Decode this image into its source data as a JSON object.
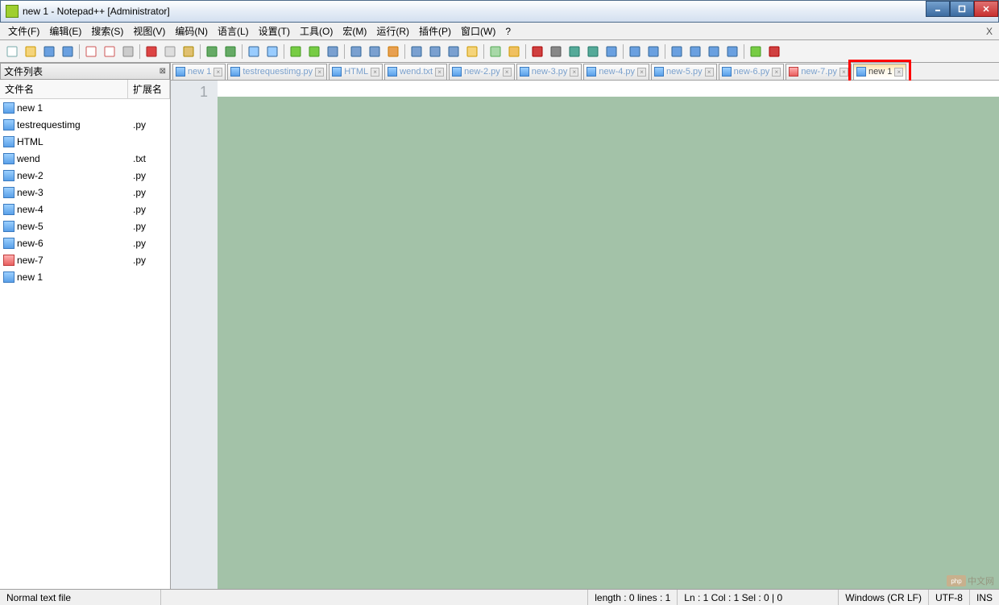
{
  "title": "new 1 - Notepad++ [Administrator]",
  "menus": [
    "文件(F)",
    "编辑(E)",
    "搜索(S)",
    "视图(V)",
    "编码(N)",
    "语言(L)",
    "设置(T)",
    "工具(O)",
    "宏(M)",
    "运行(R)",
    "插件(P)",
    "窗口(W)",
    "?"
  ],
  "sidebar": {
    "title": "文件列表",
    "col_name": "文件名",
    "col_ext": "扩展名",
    "files": [
      {
        "name": "new 1",
        "ext": "",
        "mod": false
      },
      {
        "name": "testrequestimg",
        "ext": ".py",
        "mod": false
      },
      {
        "name": "HTML",
        "ext": "",
        "mod": false
      },
      {
        "name": "wend",
        "ext": ".txt",
        "mod": false
      },
      {
        "name": "new-2",
        "ext": ".py",
        "mod": false
      },
      {
        "name": "new-3",
        "ext": ".py",
        "mod": false
      },
      {
        "name": "new-4",
        "ext": ".py",
        "mod": false
      },
      {
        "name": "new-5",
        "ext": ".py",
        "mod": false
      },
      {
        "name": "new-6",
        "ext": ".py",
        "mod": false
      },
      {
        "name": "new-7",
        "ext": ".py",
        "mod": true
      },
      {
        "name": "new 1",
        "ext": "",
        "mod": false
      }
    ]
  },
  "tabs": [
    {
      "label": "new 1",
      "mod": false,
      "active": false
    },
    {
      "label": "testrequestimg.py",
      "mod": false,
      "active": false
    },
    {
      "label": "HTML",
      "mod": false,
      "active": false
    },
    {
      "label": "wend.txt",
      "mod": false,
      "active": false
    },
    {
      "label": "new-2.py",
      "mod": false,
      "active": false
    },
    {
      "label": "new-3.py",
      "mod": false,
      "active": false
    },
    {
      "label": "new-4.py",
      "mod": false,
      "active": false
    },
    {
      "label": "new-5.py",
      "mod": false,
      "active": false
    },
    {
      "label": "new-6.py",
      "mod": false,
      "active": false
    },
    {
      "label": "new-7.py",
      "mod": true,
      "active": false
    },
    {
      "label": "new 1",
      "mod": false,
      "active": true
    }
  ],
  "gutter_line": "1",
  "status": {
    "type": "Normal text file",
    "length": "length : 0    lines : 1",
    "pos": "Ln : 1    Col : 1    Sel : 0 | 0",
    "eol": "Windows (CR LF)",
    "enc": "UTF-8",
    "ins": "INS"
  },
  "watermark": "中文网",
  "watermark_tag": "php"
}
